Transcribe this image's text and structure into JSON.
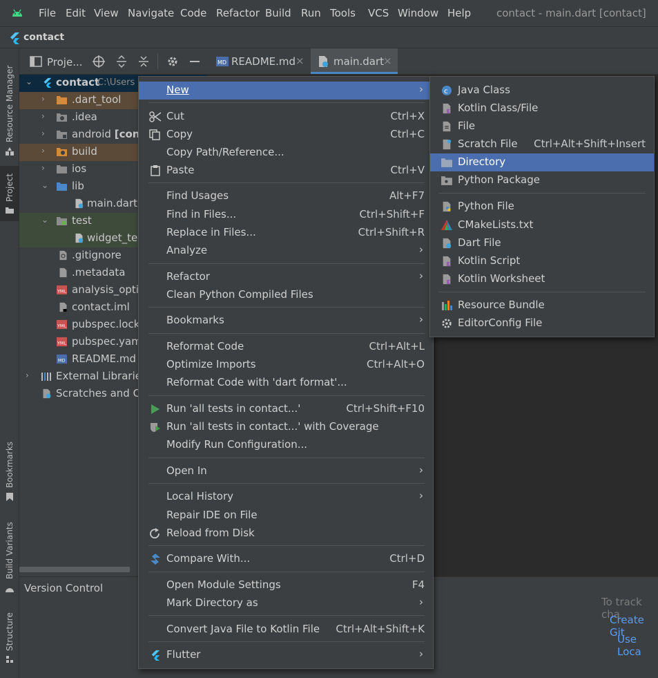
{
  "menubar": {
    "items": [
      "File",
      "Edit",
      "View",
      "Navigate",
      "Code",
      "Refactor",
      "Build",
      "Run",
      "Tools",
      "VCS",
      "Window",
      "Help"
    ],
    "window_title": "contact - main.dart [contact]"
  },
  "navbar": {
    "project": "contact"
  },
  "left_stripe": {
    "resource_manager": "Resource Manager",
    "project": "Project",
    "bookmarks": "Bookmarks",
    "build_variants": "Build Variants",
    "structure": "Structure"
  },
  "project_toolbar": {
    "label": "Proje..."
  },
  "tabs": [
    {
      "label": "README.md"
    },
    {
      "label": "main.dart"
    }
  ],
  "tree": {
    "root": {
      "label": "contact",
      "path": "C:\\Users"
    },
    "items": [
      {
        "label": ".dart_tool"
      },
      {
        "label": ".idea"
      },
      {
        "label": "android",
        "bold_suffix": "[conta"
      },
      {
        "label": "build"
      },
      {
        "label": "ios"
      },
      {
        "label": "lib"
      },
      {
        "label": "main.dart"
      },
      {
        "label": "test"
      },
      {
        "label": "widget_test"
      },
      {
        "label": ".gitignore"
      },
      {
        "label": ".metadata"
      },
      {
        "label": "analysis_option"
      },
      {
        "label": "contact.iml"
      },
      {
        "label": "pubspec.lock"
      },
      {
        "label": "pubspec.yaml"
      },
      {
        "label": "README.md"
      },
      {
        "label": "External Libraries"
      },
      {
        "label": "Scratches and Co"
      }
    ]
  },
  "version_control": {
    "title": "Version Control",
    "hint": "To track cha",
    "create_git": "Create Git",
    "use_local": "Use Loca"
  },
  "context_menu": {
    "new": "New",
    "cut": "Cut",
    "cut_key": "Ctrl+X",
    "copy": "Copy",
    "copy_key": "Ctrl+C",
    "copy_path": "Copy Path/Reference...",
    "paste": "Paste",
    "paste_key": "Ctrl+V",
    "find_usages": "Find Usages",
    "find_usages_key": "Alt+F7",
    "find_in_files": "Find in Files...",
    "find_in_files_key": "Ctrl+Shift+F",
    "replace_in_files": "Replace in Files...",
    "replace_in_files_key": "Ctrl+Shift+R",
    "analyze": "Analyze",
    "refactor": "Refactor",
    "clean_python": "Clean Python Compiled Files",
    "bookmarks": "Bookmarks",
    "reformat_code": "Reformat Code",
    "reformat_code_key": "Ctrl+Alt+L",
    "optimize_imports": "Optimize Imports",
    "optimize_imports_key": "Ctrl+Alt+O",
    "reformat_dart": "Reformat Code with 'dart format'...",
    "run_tests": "Run 'all tests in contact...'",
    "run_tests_key": "Ctrl+Shift+F10",
    "run_coverage": "Run 'all tests in contact...' with Coverage",
    "modify_run": "Modify Run Configuration...",
    "open_in": "Open In",
    "local_history": "Local History",
    "repair_ide": "Repair IDE on File",
    "reload_disk": "Reload from Disk",
    "compare_with": "Compare With...",
    "compare_with_key": "Ctrl+D",
    "module_settings": "Open Module Settings",
    "module_settings_key": "F4",
    "mark_directory": "Mark Directory as",
    "convert_java": "Convert Java File to Kotlin File",
    "convert_java_key": "Ctrl+Alt+Shift+K",
    "flutter": "Flutter"
  },
  "submenu_new": {
    "java_class": "Java Class",
    "kotlin_class": "Kotlin Class/File",
    "file": "File",
    "scratch_file": "Scratch File",
    "scratch_file_key": "Ctrl+Alt+Shift+Insert",
    "directory": "Directory",
    "python_package": "Python Package",
    "python_file": "Python File",
    "cmake": "CMakeLists.txt",
    "dart_file": "Dart File",
    "kotlin_script": "Kotlin Script",
    "kotlin_worksheet": "Kotlin Worksheet",
    "resource_bundle": "Resource Bundle",
    "editorconfig": "EditorConfig File"
  }
}
